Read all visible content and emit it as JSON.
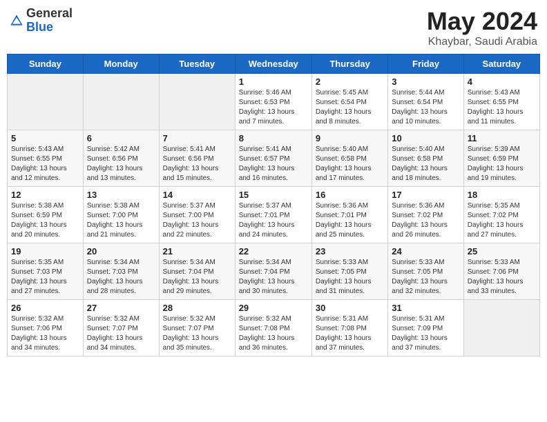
{
  "header": {
    "logo_general": "General",
    "logo_blue": "Blue",
    "title": "May 2024",
    "location": "Khaybar, Saudi Arabia"
  },
  "calendar": {
    "days_of_week": [
      "Sunday",
      "Monday",
      "Tuesday",
      "Wednesday",
      "Thursday",
      "Friday",
      "Saturday"
    ],
    "weeks": [
      [
        {
          "day": "",
          "info": ""
        },
        {
          "day": "",
          "info": ""
        },
        {
          "day": "",
          "info": ""
        },
        {
          "day": "1",
          "info": "Sunrise: 5:46 AM\nSunset: 6:53 PM\nDaylight: 13 hours\nand 7 minutes."
        },
        {
          "day": "2",
          "info": "Sunrise: 5:45 AM\nSunset: 6:54 PM\nDaylight: 13 hours\nand 8 minutes."
        },
        {
          "day": "3",
          "info": "Sunrise: 5:44 AM\nSunset: 6:54 PM\nDaylight: 13 hours\nand 10 minutes."
        },
        {
          "day": "4",
          "info": "Sunrise: 5:43 AM\nSunset: 6:55 PM\nDaylight: 13 hours\nand 11 minutes."
        }
      ],
      [
        {
          "day": "5",
          "info": "Sunrise: 5:43 AM\nSunset: 6:55 PM\nDaylight: 13 hours\nand 12 minutes."
        },
        {
          "day": "6",
          "info": "Sunrise: 5:42 AM\nSunset: 6:56 PM\nDaylight: 13 hours\nand 13 minutes."
        },
        {
          "day": "7",
          "info": "Sunrise: 5:41 AM\nSunset: 6:56 PM\nDaylight: 13 hours\nand 15 minutes."
        },
        {
          "day": "8",
          "info": "Sunrise: 5:41 AM\nSunset: 6:57 PM\nDaylight: 13 hours\nand 16 minutes."
        },
        {
          "day": "9",
          "info": "Sunrise: 5:40 AM\nSunset: 6:58 PM\nDaylight: 13 hours\nand 17 minutes."
        },
        {
          "day": "10",
          "info": "Sunrise: 5:40 AM\nSunset: 6:58 PM\nDaylight: 13 hours\nand 18 minutes."
        },
        {
          "day": "11",
          "info": "Sunrise: 5:39 AM\nSunset: 6:59 PM\nDaylight: 13 hours\nand 19 minutes."
        }
      ],
      [
        {
          "day": "12",
          "info": "Sunrise: 5:38 AM\nSunset: 6:59 PM\nDaylight: 13 hours\nand 20 minutes."
        },
        {
          "day": "13",
          "info": "Sunrise: 5:38 AM\nSunset: 7:00 PM\nDaylight: 13 hours\nand 21 minutes."
        },
        {
          "day": "14",
          "info": "Sunrise: 5:37 AM\nSunset: 7:00 PM\nDaylight: 13 hours\nand 22 minutes."
        },
        {
          "day": "15",
          "info": "Sunrise: 5:37 AM\nSunset: 7:01 PM\nDaylight: 13 hours\nand 24 minutes."
        },
        {
          "day": "16",
          "info": "Sunrise: 5:36 AM\nSunset: 7:01 PM\nDaylight: 13 hours\nand 25 minutes."
        },
        {
          "day": "17",
          "info": "Sunrise: 5:36 AM\nSunset: 7:02 PM\nDaylight: 13 hours\nand 26 minutes."
        },
        {
          "day": "18",
          "info": "Sunrise: 5:35 AM\nSunset: 7:02 PM\nDaylight: 13 hours\nand 27 minutes."
        }
      ],
      [
        {
          "day": "19",
          "info": "Sunrise: 5:35 AM\nSunset: 7:03 PM\nDaylight: 13 hours\nand 27 minutes."
        },
        {
          "day": "20",
          "info": "Sunrise: 5:34 AM\nSunset: 7:03 PM\nDaylight: 13 hours\nand 28 minutes."
        },
        {
          "day": "21",
          "info": "Sunrise: 5:34 AM\nSunset: 7:04 PM\nDaylight: 13 hours\nand 29 minutes."
        },
        {
          "day": "22",
          "info": "Sunrise: 5:34 AM\nSunset: 7:04 PM\nDaylight: 13 hours\nand 30 minutes."
        },
        {
          "day": "23",
          "info": "Sunrise: 5:33 AM\nSunset: 7:05 PM\nDaylight: 13 hours\nand 31 minutes."
        },
        {
          "day": "24",
          "info": "Sunrise: 5:33 AM\nSunset: 7:05 PM\nDaylight: 13 hours\nand 32 minutes."
        },
        {
          "day": "25",
          "info": "Sunrise: 5:33 AM\nSunset: 7:06 PM\nDaylight: 13 hours\nand 33 minutes."
        }
      ],
      [
        {
          "day": "26",
          "info": "Sunrise: 5:32 AM\nSunset: 7:06 PM\nDaylight: 13 hours\nand 34 minutes."
        },
        {
          "day": "27",
          "info": "Sunrise: 5:32 AM\nSunset: 7:07 PM\nDaylight: 13 hours\nand 34 minutes."
        },
        {
          "day": "28",
          "info": "Sunrise: 5:32 AM\nSunset: 7:07 PM\nDaylight: 13 hours\nand 35 minutes."
        },
        {
          "day": "29",
          "info": "Sunrise: 5:32 AM\nSunset: 7:08 PM\nDaylight: 13 hours\nand 36 minutes."
        },
        {
          "day": "30",
          "info": "Sunrise: 5:31 AM\nSunset: 7:08 PM\nDaylight: 13 hours\nand 37 minutes."
        },
        {
          "day": "31",
          "info": "Sunrise: 5:31 AM\nSunset: 7:09 PM\nDaylight: 13 hours\nand 37 minutes."
        },
        {
          "day": "",
          "info": ""
        }
      ]
    ]
  }
}
